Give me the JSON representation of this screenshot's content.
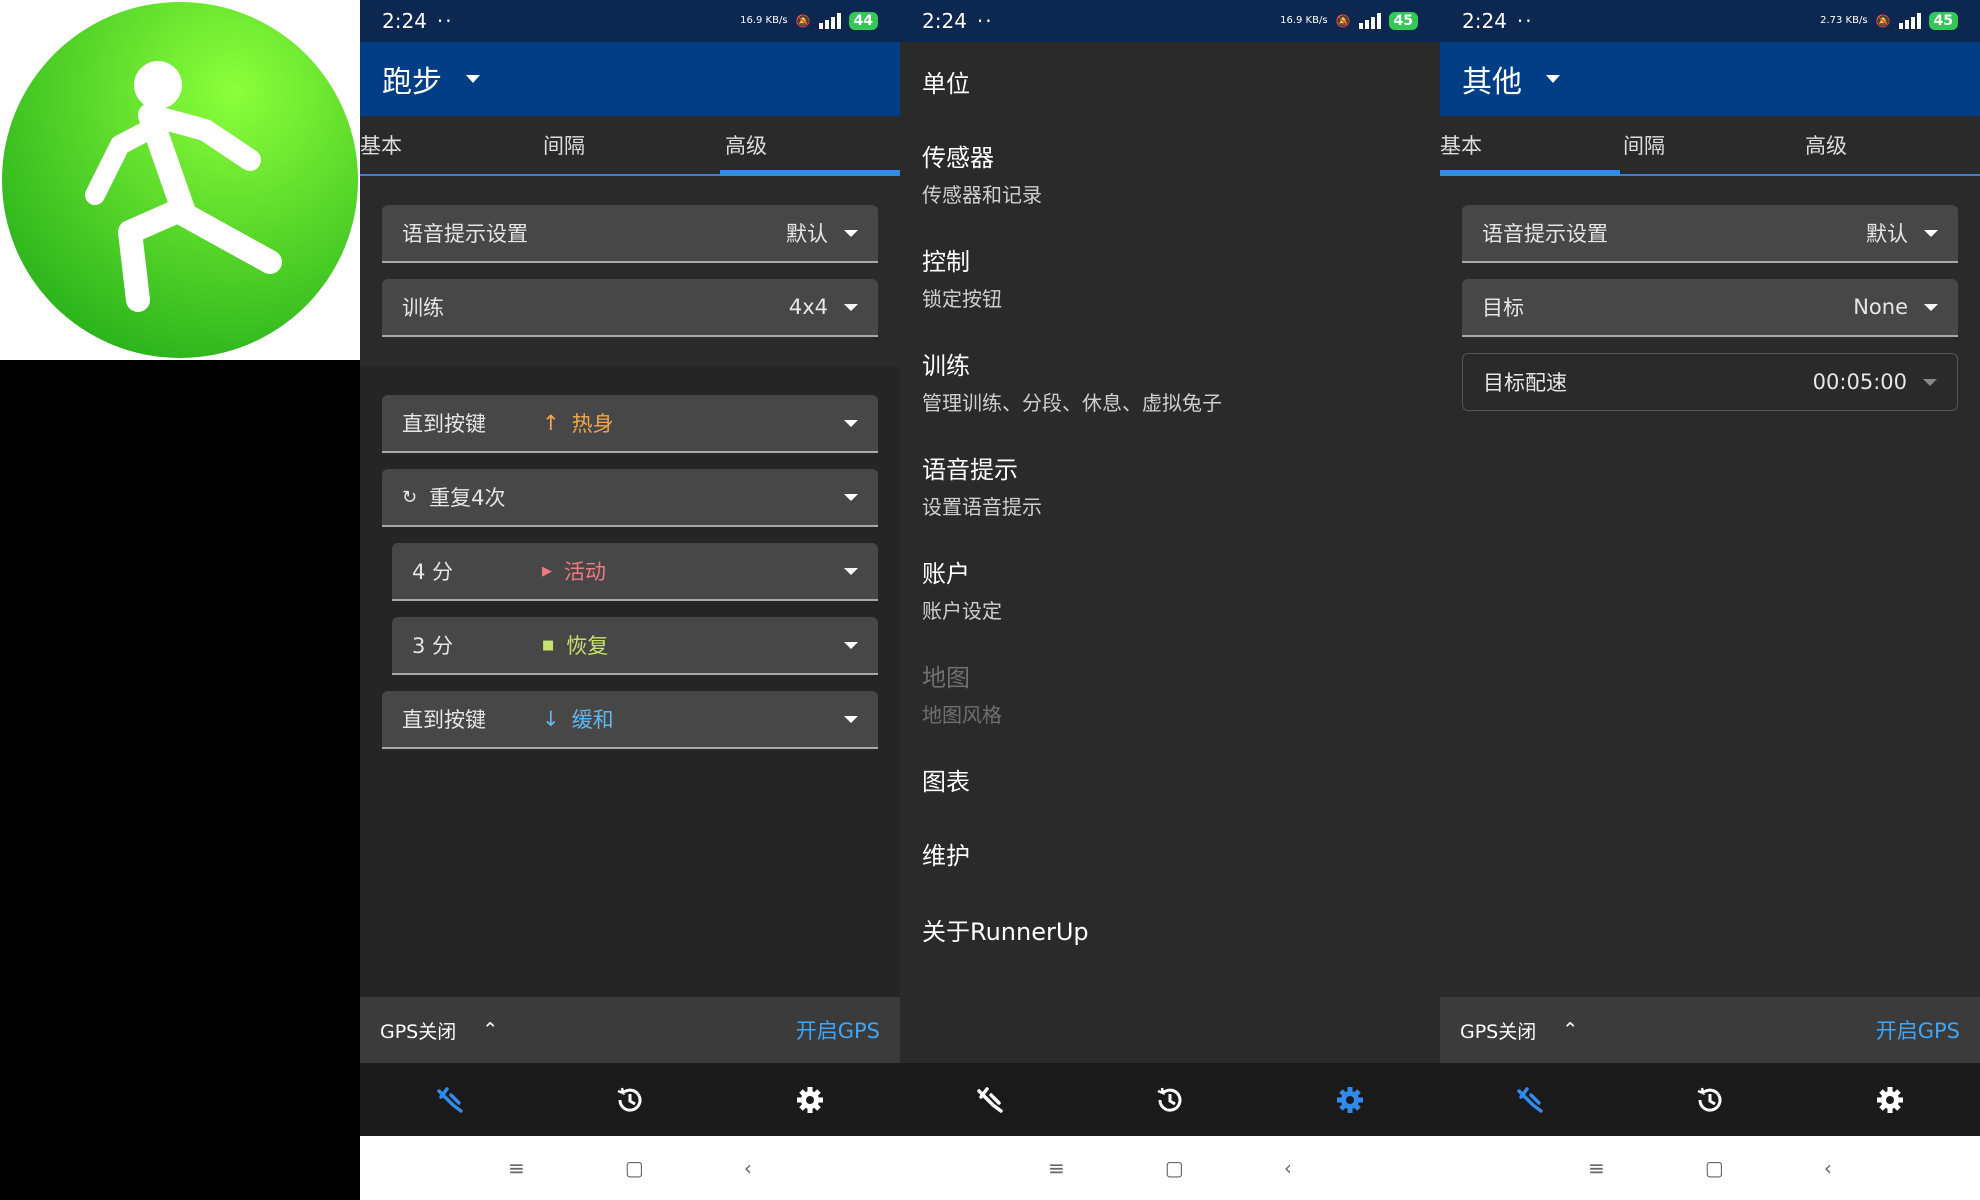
{
  "status_left": {
    "time": "2:24"
  },
  "panels": [
    {
      "status_speed": "16.9 KB/s",
      "battery": "44"
    },
    {
      "status_speed": "16.9 KB/s",
      "battery": "45"
    },
    {
      "status_speed": "2.73 KB/s",
      "battery": "45"
    }
  ],
  "panel1": {
    "title": "跑步",
    "tabs": [
      "基本",
      "间隔",
      "高级"
    ],
    "voice_label": "语音提示设置",
    "voice_value": "默认",
    "workout_label": "训练",
    "workout_value": "4x4",
    "steps": [
      {
        "left": "直到按键",
        "tag": "热身",
        "tag_color": "#f2a64a"
      },
      {
        "left": "重复4次"
      },
      {
        "left": "4 分",
        "tag": "活动",
        "tag_color": "#f07a82"
      },
      {
        "left": "3 分",
        "tag": "恢复",
        "tag_color": "#c8e070"
      },
      {
        "left": "直到按键",
        "tag": "缓和",
        "tag_color": "#5fb8f0"
      }
    ],
    "gps_status": "GPS关闭",
    "gps_action": "开启GPS"
  },
  "panel2": {
    "items": [
      {
        "title": "单位",
        "sub": ""
      },
      {
        "title": "传感器",
        "sub": "传感器和记录"
      },
      {
        "title": "控制",
        "sub": "锁定按钮"
      },
      {
        "title": "训练",
        "sub": "管理训练、分段、休息、虚拟兔子"
      },
      {
        "title": "语音提示",
        "sub": "设置语音提示"
      },
      {
        "title": "账户",
        "sub": "账户设定"
      },
      {
        "title": "地图",
        "sub": "地图风格"
      },
      {
        "title": "图表",
        "sub": ""
      },
      {
        "title": "维护",
        "sub": ""
      },
      {
        "title": "关于RunnerUp",
        "sub": ""
      }
    ]
  },
  "panel3": {
    "title": "其他",
    "tabs": [
      "基本",
      "间隔",
      "高级"
    ],
    "voice_label": "语音提示设置",
    "voice_value": "默认",
    "target_label": "目标",
    "target_value": "None",
    "pace_label": "目标配速",
    "pace_value": "00:05:00",
    "gps_status": "GPS关闭",
    "gps_action": "开启GPS"
  },
  "colors": {
    "accent": "#2f8bee",
    "appbar": "#023e86",
    "status": "#0c2750",
    "logo_green": "#33c21a"
  },
  "icons": [
    "runner-logo-icon",
    "workout-icon",
    "history-icon",
    "settings-icon"
  ]
}
